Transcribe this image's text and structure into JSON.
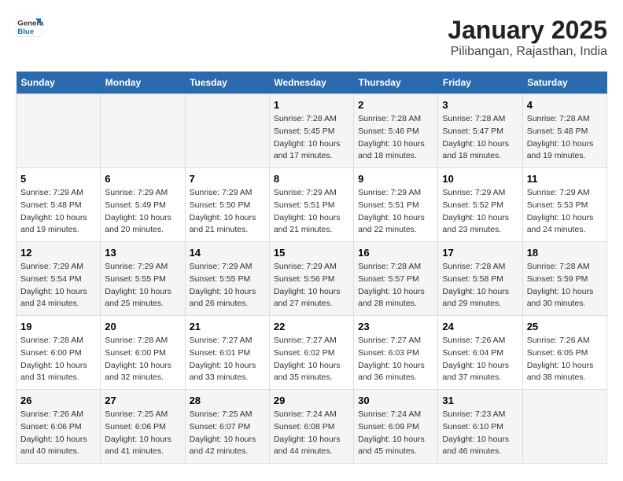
{
  "header": {
    "logo_line1": "General",
    "logo_line2": "Blue",
    "title": "January 2025",
    "subtitle": "Pilibangan, Rajasthan, India"
  },
  "days_of_week": [
    "Sunday",
    "Monday",
    "Tuesday",
    "Wednesday",
    "Thursday",
    "Friday",
    "Saturday"
  ],
  "weeks": [
    [
      {
        "day": "",
        "info": ""
      },
      {
        "day": "",
        "info": ""
      },
      {
        "day": "",
        "info": ""
      },
      {
        "day": "1",
        "info": "Sunrise: 7:28 AM\nSunset: 5:45 PM\nDaylight: 10 hours\nand 17 minutes."
      },
      {
        "day": "2",
        "info": "Sunrise: 7:28 AM\nSunset: 5:46 PM\nDaylight: 10 hours\nand 18 minutes."
      },
      {
        "day": "3",
        "info": "Sunrise: 7:28 AM\nSunset: 5:47 PM\nDaylight: 10 hours\nand 18 minutes."
      },
      {
        "day": "4",
        "info": "Sunrise: 7:28 AM\nSunset: 5:48 PM\nDaylight: 10 hours\nand 19 minutes."
      }
    ],
    [
      {
        "day": "5",
        "info": "Sunrise: 7:29 AM\nSunset: 5:48 PM\nDaylight: 10 hours\nand 19 minutes."
      },
      {
        "day": "6",
        "info": "Sunrise: 7:29 AM\nSunset: 5:49 PM\nDaylight: 10 hours\nand 20 minutes."
      },
      {
        "day": "7",
        "info": "Sunrise: 7:29 AM\nSunset: 5:50 PM\nDaylight: 10 hours\nand 21 minutes."
      },
      {
        "day": "8",
        "info": "Sunrise: 7:29 AM\nSunset: 5:51 PM\nDaylight: 10 hours\nand 21 minutes."
      },
      {
        "day": "9",
        "info": "Sunrise: 7:29 AM\nSunset: 5:51 PM\nDaylight: 10 hours\nand 22 minutes."
      },
      {
        "day": "10",
        "info": "Sunrise: 7:29 AM\nSunset: 5:52 PM\nDaylight: 10 hours\nand 23 minutes."
      },
      {
        "day": "11",
        "info": "Sunrise: 7:29 AM\nSunset: 5:53 PM\nDaylight: 10 hours\nand 24 minutes."
      }
    ],
    [
      {
        "day": "12",
        "info": "Sunrise: 7:29 AM\nSunset: 5:54 PM\nDaylight: 10 hours\nand 24 minutes."
      },
      {
        "day": "13",
        "info": "Sunrise: 7:29 AM\nSunset: 5:55 PM\nDaylight: 10 hours\nand 25 minutes."
      },
      {
        "day": "14",
        "info": "Sunrise: 7:29 AM\nSunset: 5:55 PM\nDaylight: 10 hours\nand 26 minutes."
      },
      {
        "day": "15",
        "info": "Sunrise: 7:29 AM\nSunset: 5:56 PM\nDaylight: 10 hours\nand 27 minutes."
      },
      {
        "day": "16",
        "info": "Sunrise: 7:28 AM\nSunset: 5:57 PM\nDaylight: 10 hours\nand 28 minutes."
      },
      {
        "day": "17",
        "info": "Sunrise: 7:28 AM\nSunset: 5:58 PM\nDaylight: 10 hours\nand 29 minutes."
      },
      {
        "day": "18",
        "info": "Sunrise: 7:28 AM\nSunset: 5:59 PM\nDaylight: 10 hours\nand 30 minutes."
      }
    ],
    [
      {
        "day": "19",
        "info": "Sunrise: 7:28 AM\nSunset: 6:00 PM\nDaylight: 10 hours\nand 31 minutes."
      },
      {
        "day": "20",
        "info": "Sunrise: 7:28 AM\nSunset: 6:00 PM\nDaylight: 10 hours\nand 32 minutes."
      },
      {
        "day": "21",
        "info": "Sunrise: 7:27 AM\nSunset: 6:01 PM\nDaylight: 10 hours\nand 33 minutes."
      },
      {
        "day": "22",
        "info": "Sunrise: 7:27 AM\nSunset: 6:02 PM\nDaylight: 10 hours\nand 35 minutes."
      },
      {
        "day": "23",
        "info": "Sunrise: 7:27 AM\nSunset: 6:03 PM\nDaylight: 10 hours\nand 36 minutes."
      },
      {
        "day": "24",
        "info": "Sunrise: 7:26 AM\nSunset: 6:04 PM\nDaylight: 10 hours\nand 37 minutes."
      },
      {
        "day": "25",
        "info": "Sunrise: 7:26 AM\nSunset: 6:05 PM\nDaylight: 10 hours\nand 38 minutes."
      }
    ],
    [
      {
        "day": "26",
        "info": "Sunrise: 7:26 AM\nSunset: 6:06 PM\nDaylight: 10 hours\nand 40 minutes."
      },
      {
        "day": "27",
        "info": "Sunrise: 7:25 AM\nSunset: 6:06 PM\nDaylight: 10 hours\nand 41 minutes."
      },
      {
        "day": "28",
        "info": "Sunrise: 7:25 AM\nSunset: 6:07 PM\nDaylight: 10 hours\nand 42 minutes."
      },
      {
        "day": "29",
        "info": "Sunrise: 7:24 AM\nSunset: 6:08 PM\nDaylight: 10 hours\nand 44 minutes."
      },
      {
        "day": "30",
        "info": "Sunrise: 7:24 AM\nSunset: 6:09 PM\nDaylight: 10 hours\nand 45 minutes."
      },
      {
        "day": "31",
        "info": "Sunrise: 7:23 AM\nSunset: 6:10 PM\nDaylight: 10 hours\nand 46 minutes."
      },
      {
        "day": "",
        "info": ""
      }
    ]
  ]
}
